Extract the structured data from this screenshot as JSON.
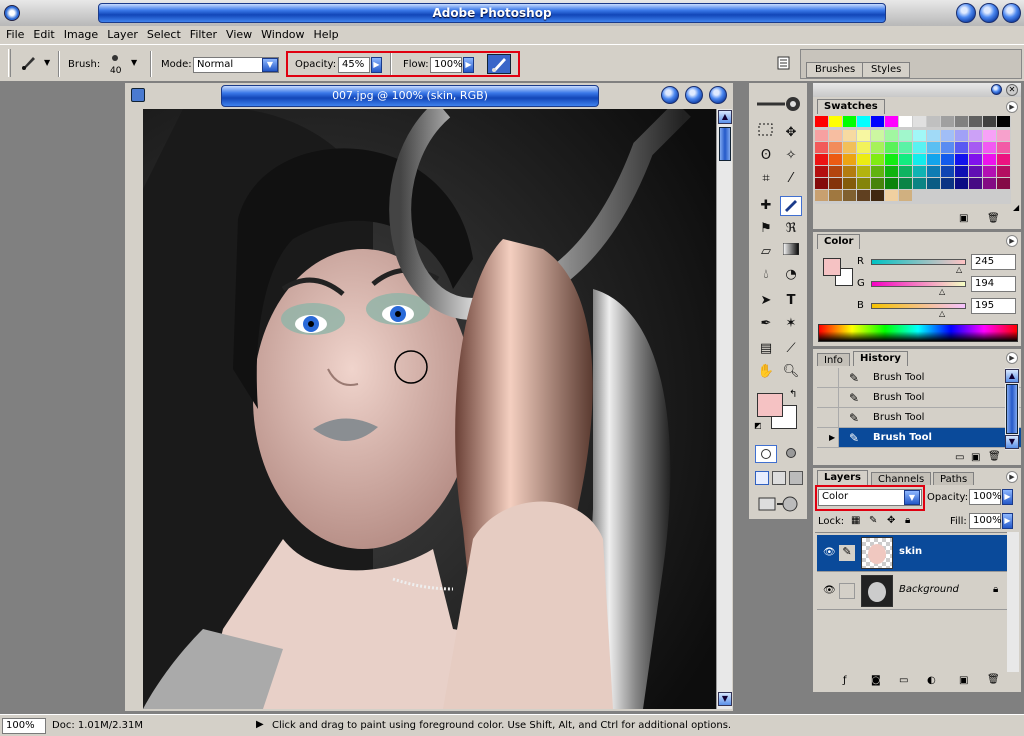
{
  "app": {
    "title": "Adobe Photoshop"
  },
  "menu": [
    "File",
    "Edit",
    "Image",
    "Layer",
    "Select",
    "Filter",
    "View",
    "Window",
    "Help"
  ],
  "options": {
    "brush_label": "Brush:",
    "brush_size": "40",
    "mode_label": "Mode:",
    "mode_value": "Normal",
    "opacity_label": "Opacity:",
    "opacity_value": "45%",
    "flow_label": "Flow:",
    "flow_value": "100%"
  },
  "palette_well": {
    "tabs": [
      "Brushes",
      "Styles"
    ]
  },
  "document": {
    "title": "007.jpg @ 100% (skin, RGB)"
  },
  "swatches": {
    "title": "Swatches"
  },
  "color": {
    "title": "Color",
    "r_label": "R",
    "g_label": "G",
    "b_label": "B",
    "r": "245",
    "g": "194",
    "b": "195",
    "fg_color": "#f5c2c3",
    "bg_color": "#ffffff"
  },
  "history": {
    "tabs": [
      "Info",
      "History"
    ],
    "items": [
      "Brush Tool",
      "Brush Tool",
      "Brush Tool",
      "Brush Tool"
    ],
    "selected_index": 3
  },
  "layers": {
    "tabs": [
      "Layers",
      "Channels",
      "Paths"
    ],
    "blend_mode": "Color",
    "opacity_label": "Opacity:",
    "opacity_value": "100%",
    "lock_label": "Lock:",
    "fill_label": "Fill:",
    "fill_value": "100%",
    "items": [
      {
        "name": "skin",
        "selected": true
      },
      {
        "name": "Background",
        "selected": false
      }
    ]
  },
  "status": {
    "zoom": "100%",
    "doc_size": "Doc: 1.01M/2.31M",
    "hint": "Click and drag to paint using foreground color.  Use Shift, Alt, and Ctrl for additional options."
  },
  "colors": {
    "accent_blue": "#0a4a9a",
    "highlight_red": "#e00010"
  }
}
